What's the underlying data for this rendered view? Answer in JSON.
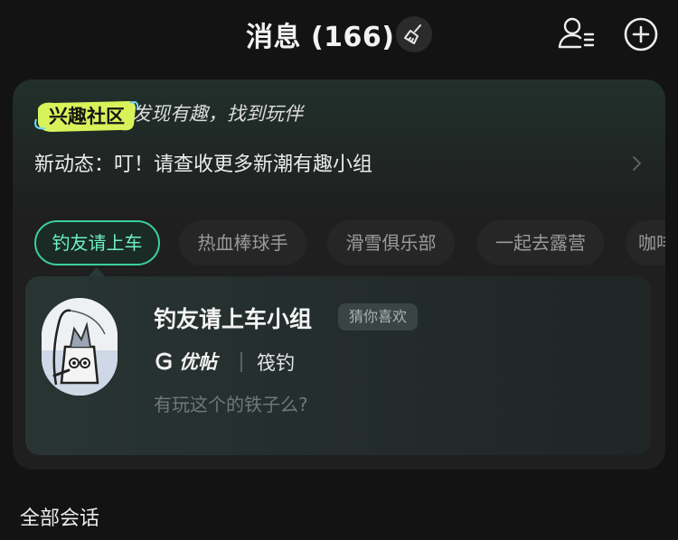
{
  "header": {
    "title": "消息 (166)",
    "icons": [
      "broom-icon",
      "contact-list-icon",
      "add-circle-icon"
    ]
  },
  "community": {
    "logo_text": "兴趣社区",
    "slogan": "发现有趣，找到玩伴",
    "news": "新动态：叮！请查收更多新潮有趣小组",
    "tabs": [
      {
        "label": "钓友请上车",
        "active": true
      },
      {
        "label": "热血棒球手",
        "active": false
      },
      {
        "label": "滑雪俱乐部",
        "active": false
      },
      {
        "label": "一起去露营",
        "active": false
      },
      {
        "label": "咖啡",
        "active": false
      }
    ],
    "group": {
      "name": "钓友请上车小组",
      "badge": "猜你喜欢",
      "brand": "优帖",
      "category": "筏钓",
      "preview": "有玩这个的铁子么?"
    }
  },
  "section": {
    "label": "全部会话"
  },
  "colors": {
    "accent": "#3ccf9e",
    "background": "#131313",
    "card": "#1f1f20"
  }
}
